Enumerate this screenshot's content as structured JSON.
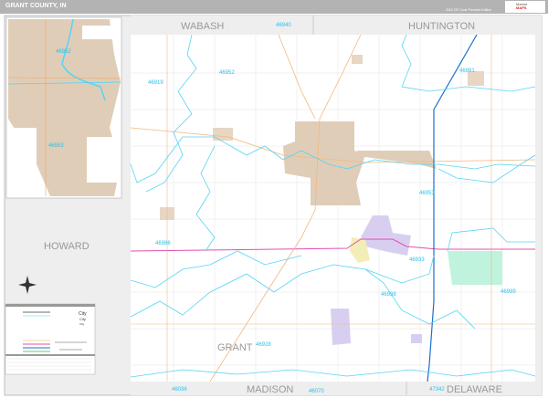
{
  "header": {
    "title": "GRANT COUNTY, IN",
    "edition": "2020 ZIP Code Premium Edition",
    "logo_line1": "Market",
    "logo_line2": "MAPS"
  },
  "counties": {
    "wabash": "WABASH",
    "huntington": "HUNTINGTON",
    "howard": "HOWARD",
    "grant": "GRANT",
    "madison": "MADISON",
    "delaware": "DELAWARE"
  },
  "zips": {
    "z46940": "46940",
    "z46952": "46952",
    "z46919": "46919",
    "z46991": "46991",
    "z46953": "46953",
    "z46986": "46986",
    "z46933": "46933",
    "z46938": "46938",
    "z46989": "46989",
    "z46928": "46928",
    "z46036": "46036",
    "z46070": "46070",
    "z47342": "47342"
  },
  "inset": {
    "zip1": "46952",
    "zip2": "46953"
  },
  "legend": {
    "city1": "City",
    "city2": "City",
    "city3": "City"
  },
  "colors": {
    "zip_boundary": "#55d4f5",
    "urban": "#e0cdb8",
    "highway": "#f0a860",
    "us_route": "#e050b0",
    "interstate": "#1a6fd0"
  }
}
